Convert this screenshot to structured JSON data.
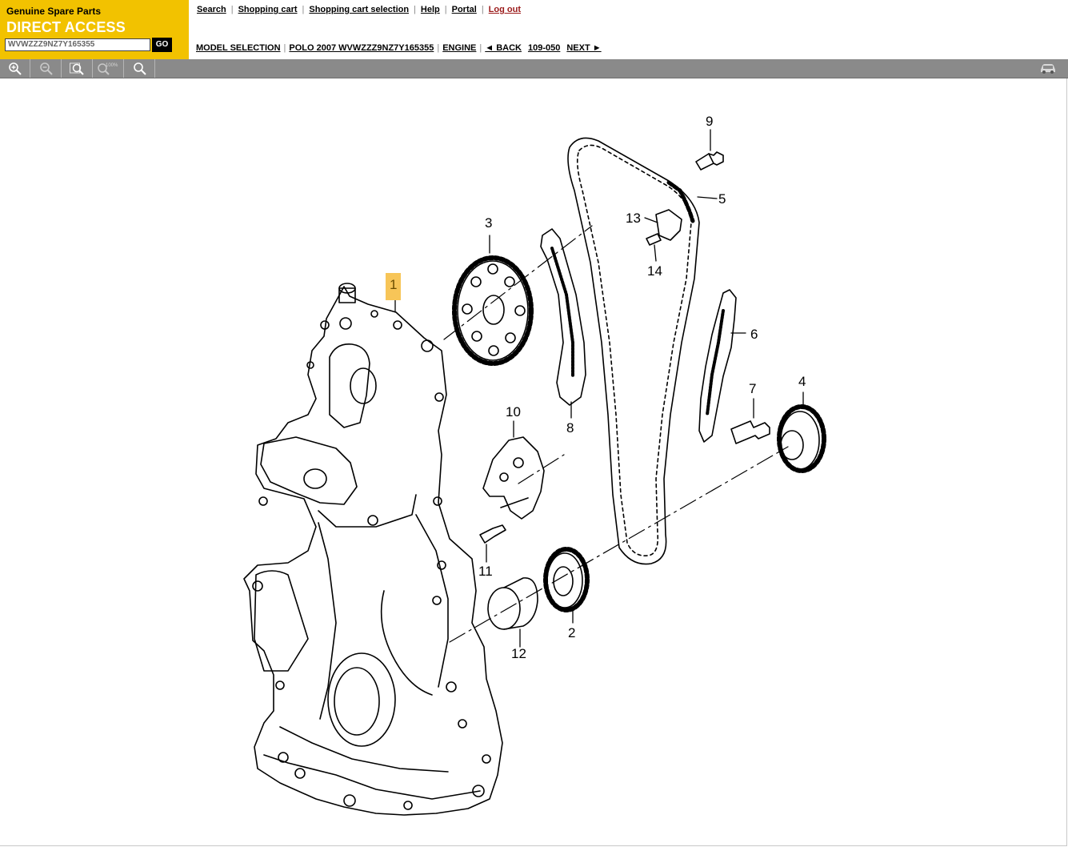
{
  "brand": {
    "subtitle": "Genuine Spare Parts",
    "title": "DIRECT ACCESS",
    "vin_value": "WVWZZZ9NZ7Y165355",
    "go_label": "GO",
    "color": "#f2c200"
  },
  "topnav": {
    "items": [
      "Search",
      "Shopping cart",
      "Shopping cart selection",
      "Help",
      "Portal",
      "Log out"
    ],
    "separator": "|"
  },
  "breadcrumb": {
    "model_selection": "MODEL SELECTION",
    "vehicle": "POLO 2007 WVWZZZ9NZ7Y165355",
    "group": "ENGINE",
    "back": "◄ BACK",
    "code": "109-050",
    "next": "NEXT ►"
  },
  "toolbar": {
    "buttons": [
      "zoom-in-icon",
      "zoom-out-icon",
      "zoom-fit-icon",
      "zoom-100-icon",
      "search-icon"
    ],
    "zoom_100_label": "100%",
    "right_icon": "car-icon",
    "background": "#8a8a8a"
  },
  "diagram": {
    "selected_part": "1",
    "highlight_color": "#f7c558",
    "callouts": [
      "1",
      "2",
      "3",
      "4",
      "5",
      "6",
      "7",
      "8",
      "9",
      "10",
      "11",
      "12",
      "13",
      "14"
    ]
  }
}
